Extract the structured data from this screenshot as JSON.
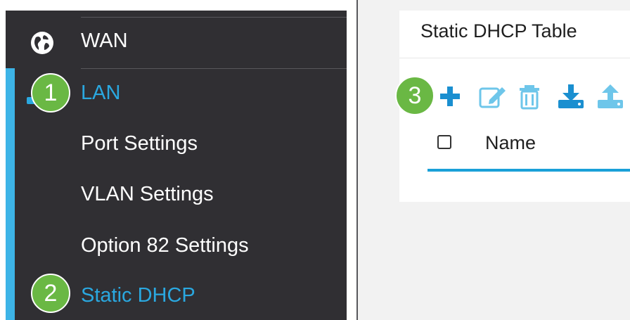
{
  "sidebar": {
    "items": [
      {
        "label": "WAN",
        "icon": "globe-icon"
      },
      {
        "label": "LAN",
        "active": true
      },
      {
        "label": "Port Settings"
      },
      {
        "label": "VLAN Settings"
      },
      {
        "label": "Option 82 Settings"
      },
      {
        "label": "Static DHCP",
        "active": true
      }
    ]
  },
  "main": {
    "card_title": "Static DHCP Table",
    "toolbar": [
      "add-icon",
      "edit-icon",
      "delete-icon",
      "import-icon",
      "export-icon"
    ],
    "columns": [
      "Name"
    ]
  },
  "badges": [
    "1",
    "2",
    "3"
  ],
  "colors": {
    "sidebar_bg": "#302f33",
    "accent": "#2aa8e0",
    "badge_green": "#6ab844"
  }
}
